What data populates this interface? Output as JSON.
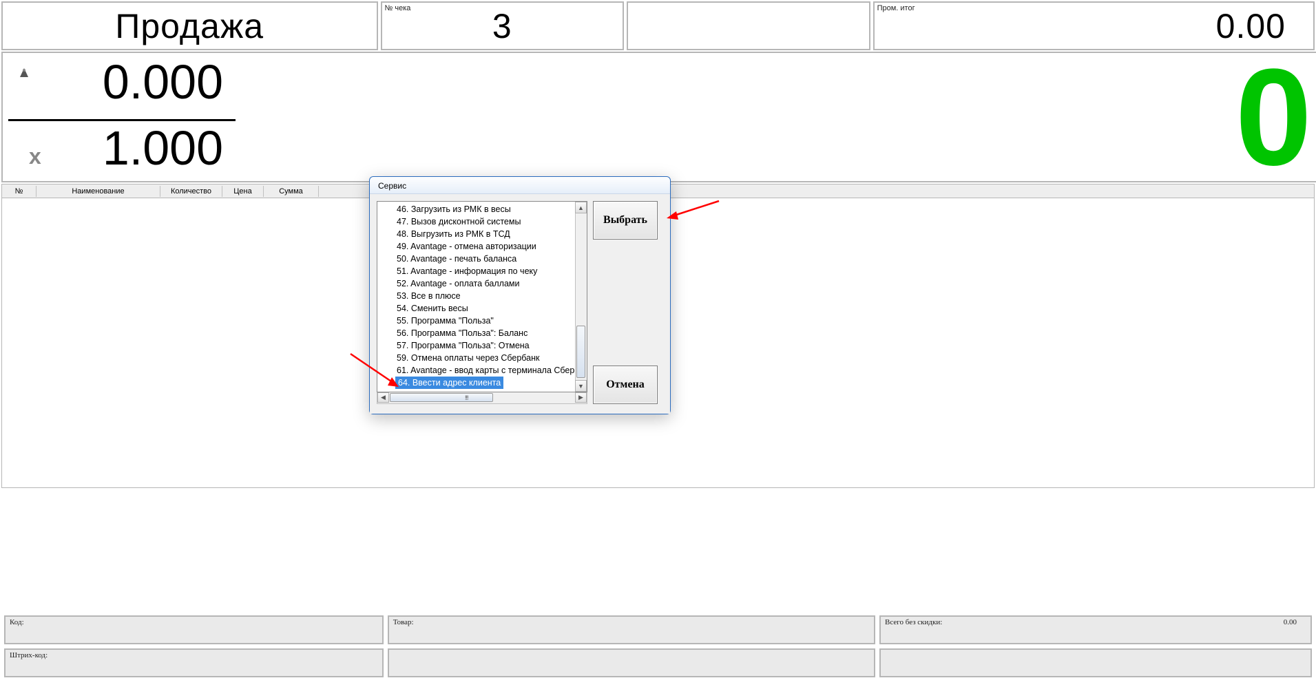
{
  "header": {
    "sale_caption": "Продажа",
    "receipt_label": "№ чека",
    "receipt_no": "3",
    "subtotal_label": "Пром. итог",
    "subtotal_value": "0.00"
  },
  "weight": {
    "qty_weight": "0.000",
    "qty_mult": "1.000",
    "line_total": "0"
  },
  "columns": {
    "no": "№",
    "name": "Наименование",
    "qty": "Количество",
    "price": "Цена",
    "sum": "Сумма"
  },
  "bottom": {
    "code_label": "Код:",
    "good_label": "Товар:",
    "total_label": "Всего без скидки:",
    "total_value": "0.00",
    "barcode_label": "Штрих-код:"
  },
  "dialog": {
    "title": "Сервис",
    "select_btn": "Выбрать",
    "cancel_btn": "Отмена",
    "hmarker": "!!!",
    "items": [
      "46. Загрузить из РМК в весы",
      "47. Вызов дисконтной системы",
      "48. Выгрузить из РМК в ТСД",
      "49. Avantage - отмена авторизации",
      "50. Avantage - печать баланса",
      "51. Avantage - информация по чеку",
      "52. Avantage - оплата баллами",
      "53. Все в плюсе",
      "54. Сменить весы",
      "55. Программа \"Польза\"",
      "56. Программа \"Польза\": Баланс",
      "57. Программа \"Польза\": Отмена",
      "59. Отмена оплаты через Сбербанк",
      "61. Avantage - ввод карты с терминала Сбер",
      "64. Ввести адрес клиента"
    ],
    "selected_index": 14
  }
}
